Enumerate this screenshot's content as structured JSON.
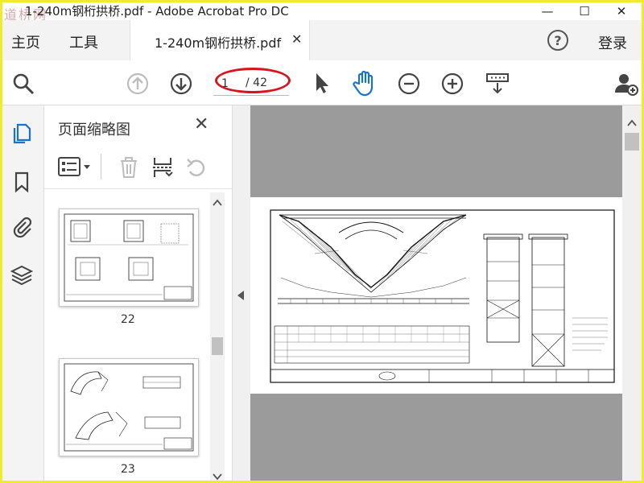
{
  "window": {
    "title": "1-240m钢桁拱桥.pdf - Adobe Acrobat Pro DC",
    "watermark": "道桥网"
  },
  "tabs": {
    "home": "主页",
    "tools": "工具",
    "document": "1-240m钢桁拱桥.pdf",
    "login": "登录"
  },
  "toolbar": {
    "current_page": "1",
    "total_pages": "/ 42"
  },
  "panel": {
    "title": "页面缩略图",
    "thumbnails": [
      {
        "label": "22"
      },
      {
        "label": "23"
      }
    ]
  },
  "colors": {
    "accent_blue": "#1a73c8",
    "highlight_red": "#d8141f",
    "frame_yellow": "#f1ec2b"
  },
  "icons": [
    "search-icon",
    "prev-page-icon",
    "next-page-icon",
    "select-arrow-icon",
    "hand-icon",
    "zoom-out-icon",
    "zoom-in-icon",
    "scroll-mode-icon",
    "add-user-icon",
    "pages-icon",
    "bookmark-icon",
    "attachment-icon",
    "layers-icon",
    "options-icon",
    "delete-icon",
    "extract-icon",
    "rotate-icon"
  ]
}
